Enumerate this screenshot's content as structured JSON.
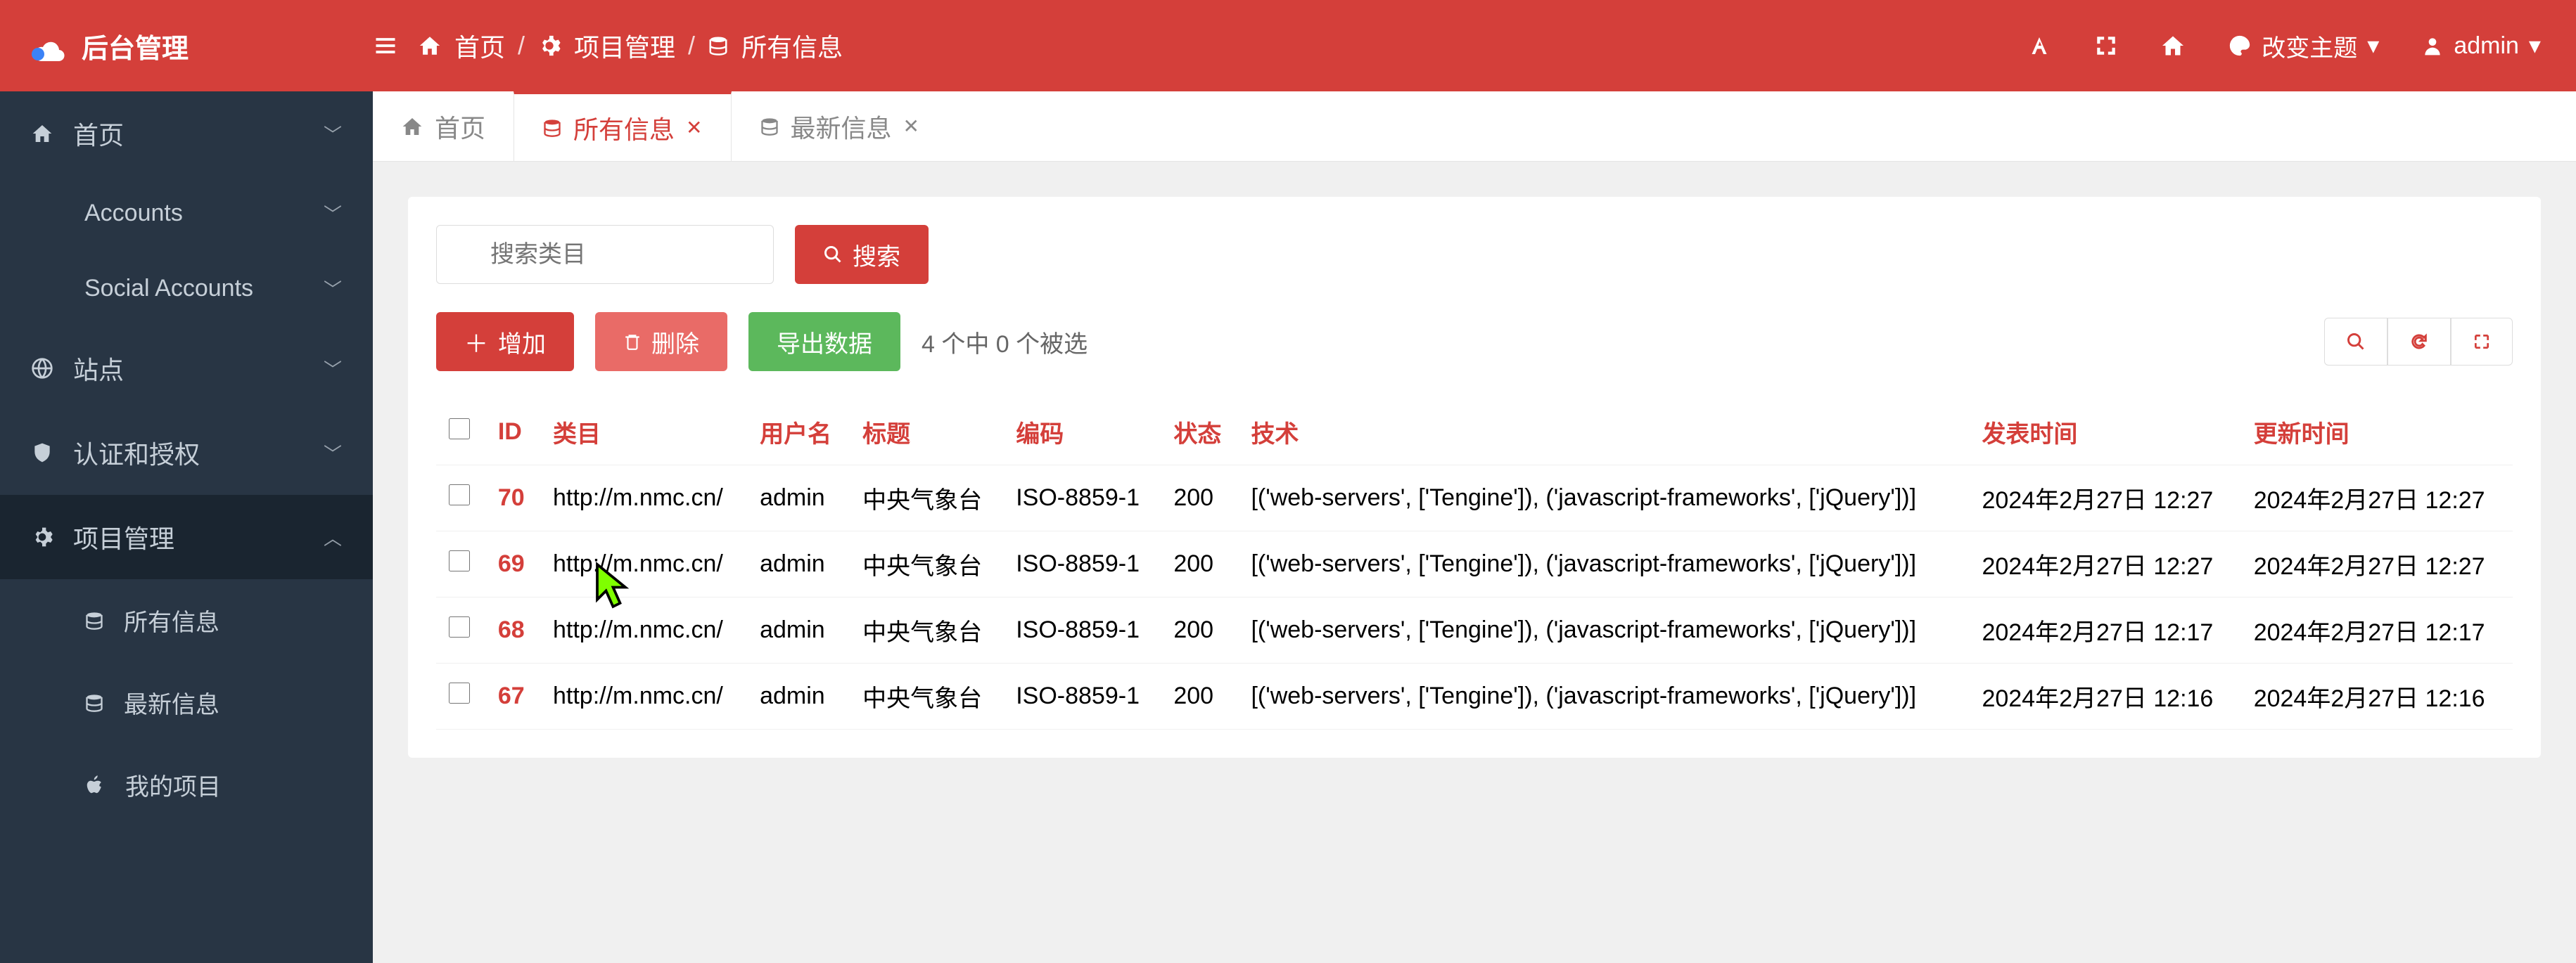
{
  "header": {
    "logo_text": "后台管理",
    "breadcrumb": [
      {
        "icon": "home",
        "label": "首页"
      },
      {
        "icon": "gear",
        "label": "项目管理"
      },
      {
        "icon": "db",
        "label": "所有信息"
      }
    ],
    "theme_label": "改变主题",
    "user_label": "admin"
  },
  "sidebar": {
    "items": [
      {
        "icon": "home",
        "label": "首页",
        "chev": "down"
      },
      {
        "icon": "",
        "label": "Accounts",
        "chev": "down",
        "sub": true
      },
      {
        "icon": "",
        "label": "Social Accounts",
        "chev": "down",
        "sub": true
      },
      {
        "icon": "globe",
        "label": "站点",
        "chev": "down"
      },
      {
        "icon": "shield",
        "label": "认证和授权",
        "chev": "down"
      },
      {
        "icon": "gear",
        "label": "项目管理",
        "chev": "up",
        "active": true
      },
      {
        "icon": "db",
        "label": "所有信息",
        "sub2": true
      },
      {
        "icon": "db",
        "label": "最新信息",
        "sub2": true
      },
      {
        "icon": "apple",
        "label": "我的项目",
        "sub2": true
      }
    ]
  },
  "tabs": [
    {
      "icon": "home",
      "label": "首页",
      "closable": false,
      "active": false
    },
    {
      "icon": "db",
      "label": "所有信息",
      "closable": true,
      "active": true
    },
    {
      "icon": "db",
      "label": "最新信息",
      "closable": true,
      "active": false
    }
  ],
  "search": {
    "placeholder": "搜索类目",
    "button": "搜索"
  },
  "actions": {
    "add": "增加",
    "delete": "删除",
    "export": "导出数据",
    "selection": "4 个中 0 个被选"
  },
  "table": {
    "headers": [
      "ID",
      "类目",
      "用户名",
      "标题",
      "编码",
      "状态",
      "技术",
      "发表时间",
      "更新时间"
    ],
    "rows": [
      {
        "id": "70",
        "category": "http://m.nmc.cn/",
        "user": "admin",
        "title": "中央气象台",
        "enc": "ISO-8859-1",
        "status": "200",
        "tech": "[('web-servers', ['Tengine']), ('javascript-frameworks', ['jQuery'])]",
        "pub": "2024年2月27日 12:27",
        "upd": "2024年2月27日 12:27"
      },
      {
        "id": "69",
        "category": "http://m.nmc.cn/",
        "user": "admin",
        "title": "中央气象台",
        "enc": "ISO-8859-1",
        "status": "200",
        "tech": "[('web-servers', ['Tengine']), ('javascript-frameworks', ['jQuery'])]",
        "pub": "2024年2月27日 12:27",
        "upd": "2024年2月27日 12:27"
      },
      {
        "id": "68",
        "category": "http://m.nmc.cn/",
        "user": "admin",
        "title": "中央气象台",
        "enc": "ISO-8859-1",
        "status": "200",
        "tech": "[('web-servers', ['Tengine']), ('javascript-frameworks', ['jQuery'])]",
        "pub": "2024年2月27日 12:17",
        "upd": "2024年2月27日 12:17"
      },
      {
        "id": "67",
        "category": "http://m.nmc.cn/",
        "user": "admin",
        "title": "中央气象台",
        "enc": "ISO-8859-1",
        "status": "200",
        "tech": "[('web-servers', ['Tengine']), ('javascript-frameworks', ['jQuery'])]",
        "pub": "2024年2月27日 12:16",
        "upd": "2024年2月27日 12:16"
      }
    ]
  }
}
